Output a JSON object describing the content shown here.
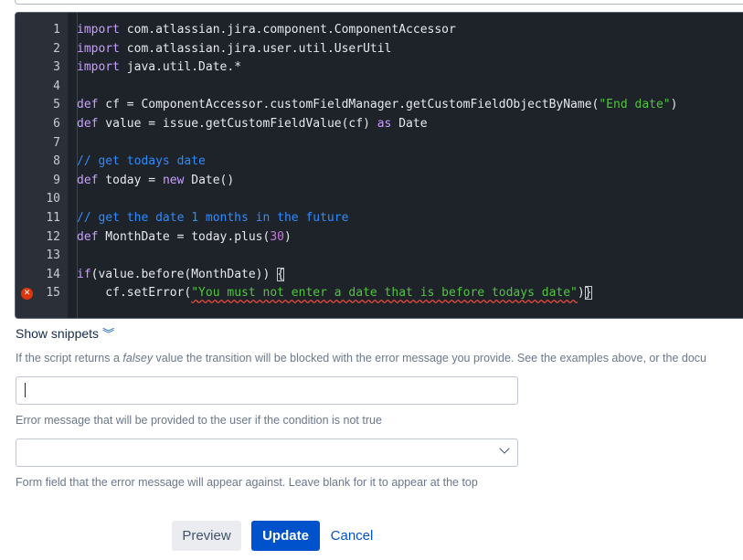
{
  "editor": {
    "lines": [
      {
        "n": "1",
        "tokens": [
          {
            "t": "import",
            "c": "kw"
          },
          {
            "t": " com.atlassian.jira.component.ComponentAccessor",
            "c": ""
          }
        ]
      },
      {
        "n": "2",
        "tokens": [
          {
            "t": "import",
            "c": "kw"
          },
          {
            "t": " com.atlassian.jira.user.util.UserUtil",
            "c": ""
          }
        ]
      },
      {
        "n": "3",
        "tokens": [
          {
            "t": "import",
            "c": "kw"
          },
          {
            "t": " java.util.Date.*",
            "c": ""
          }
        ]
      },
      {
        "n": "4",
        "tokens": []
      },
      {
        "n": "5",
        "tokens": [
          {
            "t": "def",
            "c": "kw"
          },
          {
            "t": " cf = ComponentAccessor.customFieldManager.getCustomFieldObjectByName(",
            "c": ""
          },
          {
            "t": "\"End date\"",
            "c": "str"
          },
          {
            "t": ")",
            "c": ""
          }
        ]
      },
      {
        "n": "6",
        "tokens": [
          {
            "t": "def",
            "c": "kw"
          },
          {
            "t": " value = issue.getCustomFieldValue(cf) ",
            "c": ""
          },
          {
            "t": "as",
            "c": "kw"
          },
          {
            "t": " Date",
            "c": ""
          }
        ]
      },
      {
        "n": "7",
        "tokens": []
      },
      {
        "n": "8",
        "tokens": [
          {
            "t": "// get todays date",
            "c": "cm"
          }
        ]
      },
      {
        "n": "9",
        "tokens": [
          {
            "t": "def",
            "c": "kw"
          },
          {
            "t": " today = ",
            "c": ""
          },
          {
            "t": "new",
            "c": "kw"
          },
          {
            "t": " Date()",
            "c": ""
          }
        ]
      },
      {
        "n": "10",
        "tokens": []
      },
      {
        "n": "11",
        "tokens": [
          {
            "t": "// get the date 1 months in the future",
            "c": "cm"
          }
        ]
      },
      {
        "n": "12",
        "tokens": [
          {
            "t": "def",
            "c": "kw"
          },
          {
            "t": " MonthDate = today.plus(",
            "c": ""
          },
          {
            "t": "30",
            "c": "num"
          },
          {
            "t": ")",
            "c": ""
          }
        ]
      },
      {
        "n": "13",
        "tokens": []
      },
      {
        "n": "14",
        "tokens": [
          {
            "t": "if",
            "c": "kw"
          },
          {
            "t": "(value.before(MonthDate)) ",
            "c": ""
          },
          {
            "t": "{",
            "c": "bracket"
          }
        ]
      },
      {
        "n": "15",
        "error": true,
        "tokens": [
          {
            "t": "    cf.setError(",
            "c": ""
          },
          {
            "t": "\"You must not enter a date that is before todays date\"",
            "c": "err-str"
          },
          {
            "t": ")",
            "c": ""
          },
          {
            "t": "}",
            "c": "bracket"
          }
        ]
      }
    ]
  },
  "snippets": {
    "label": "Show snippets",
    "icon": "double-chevron-down-icon"
  },
  "help_text": {
    "before": "If the script returns a ",
    "italic": "falsey",
    "after": " value the transition will be blocked with the error message you provide. See the examples above, or the docu"
  },
  "error_message_field": {
    "value": "",
    "help": "Error message that will be provided to the user if the condition is not true"
  },
  "form_field_select": {
    "value": "",
    "help": "Form field that the error message will appear against. Leave blank for it to appear at the top"
  },
  "buttons": {
    "preview": "Preview",
    "update": "Update",
    "cancel": "Cancel"
  },
  "colors": {
    "accent": "#0052cc",
    "editor_bg": "#1e2229",
    "error": "#de350b"
  }
}
